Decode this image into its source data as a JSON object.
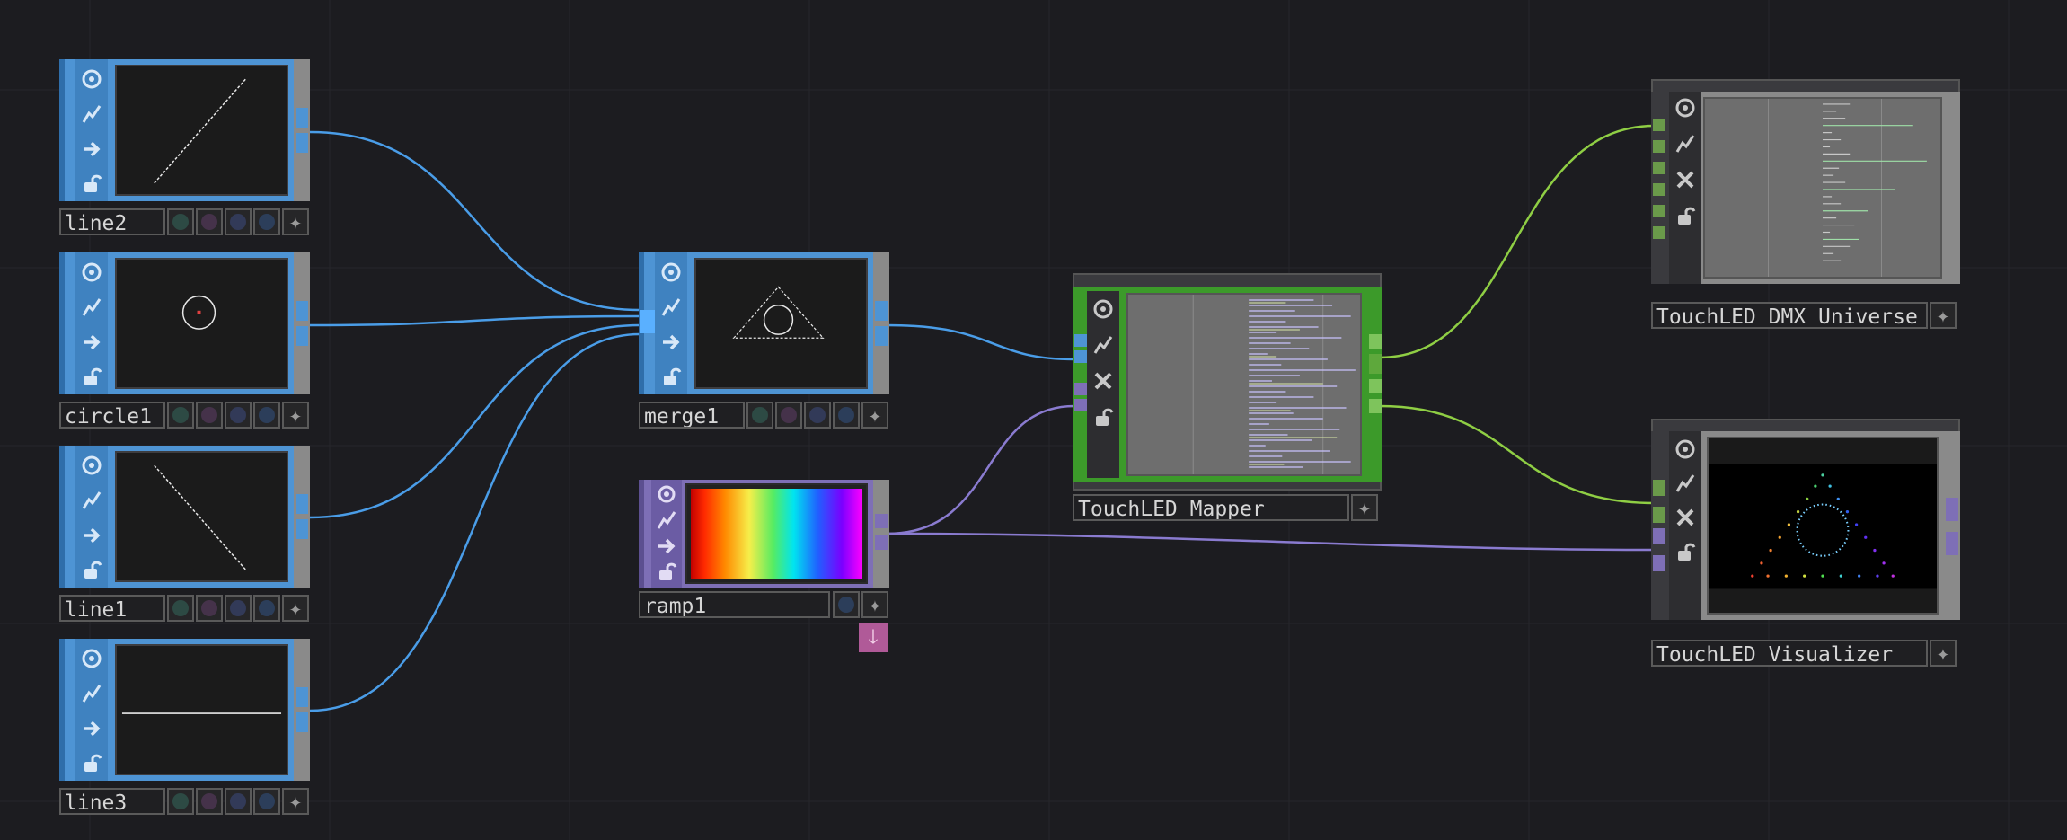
{
  "colors": {
    "background": "#1c1c20",
    "sop_blue": "#4e94d4",
    "top_purple": "#7e6fb6",
    "chop_green": "#3c9a2a",
    "dat_gray": "#8a8a8a",
    "wire_blue": "#4a9de8",
    "wire_green": "#8fce44",
    "wire_purple": "#8a7bd0"
  },
  "icons": {
    "viewer": "viewer-icon",
    "bypass": "bypass-icon",
    "display": "display-icon",
    "lock": "lock-icon",
    "cooking": "cooking-off-icon",
    "add": "add-icon",
    "export": "export-down-icon"
  },
  "nodes": {
    "line2": {
      "label": "line2"
    },
    "circle1": {
      "label": "circle1"
    },
    "line1": {
      "label": "line1"
    },
    "line3": {
      "label": "line3"
    },
    "merge1": {
      "label": "merge1"
    },
    "ramp1": {
      "label": "ramp1"
    },
    "mapper": {
      "label": "TouchLED_Mapper"
    },
    "dmx": {
      "label": "TouchLED_DMX_Universe"
    },
    "visualizer": {
      "label": "TouchLED_Visualizer"
    }
  }
}
